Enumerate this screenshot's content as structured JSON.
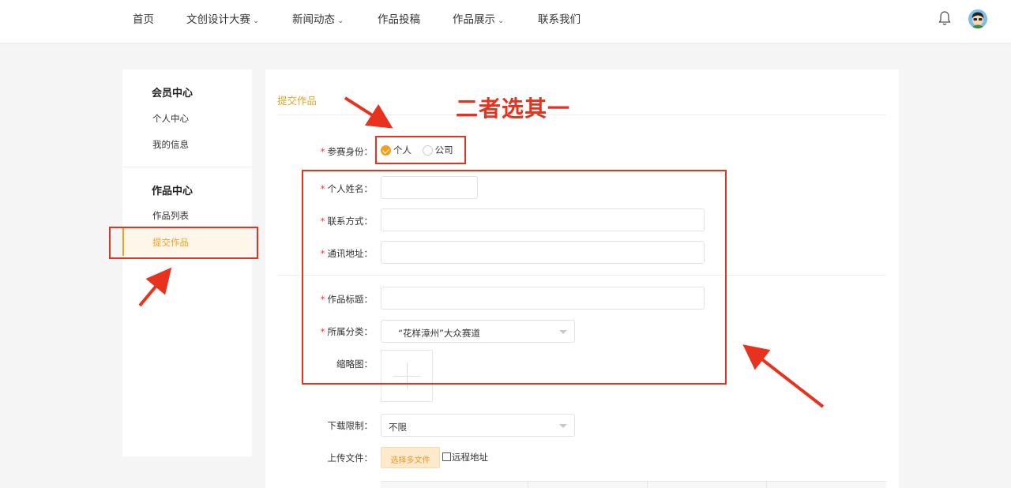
{
  "nav": {
    "items": [
      {
        "label": "首页",
        "has_dropdown": false
      },
      {
        "label": "文创设计大赛",
        "has_dropdown": true
      },
      {
        "label": "新闻动态",
        "has_dropdown": true
      },
      {
        "label": "作品投稿",
        "has_dropdown": false
      },
      {
        "label": "作品展示",
        "has_dropdown": true
      },
      {
        "label": "联系我们",
        "has_dropdown": false
      }
    ],
    "chevron": "⌄",
    "icons": [
      "bell-icon",
      "avatar"
    ]
  },
  "sidebar": {
    "groups": [
      {
        "title": "会员中心",
        "items": [
          {
            "label": "个人中心"
          },
          {
            "label": "我的信息"
          }
        ]
      },
      {
        "title": "作品中心",
        "items": [
          {
            "label": "作品列表"
          },
          {
            "label": "提交作品",
            "active": true
          }
        ]
      }
    ]
  },
  "form": {
    "title": "提交作品",
    "identity": {
      "label": "参赛身份：",
      "options": [
        {
          "label": "个人",
          "checked": true
        },
        {
          "label": "公司",
          "checked": false
        }
      ]
    },
    "name": {
      "label": "个人姓名：",
      "value": ""
    },
    "contact": {
      "label": "联系方式：",
      "value": ""
    },
    "address": {
      "label": "通讯地址：",
      "value": ""
    },
    "work_title": {
      "label": "作品标题：",
      "value": ""
    },
    "category": {
      "label": "所属分类：",
      "value": "“花样漳州”大众赛道"
    },
    "thumbnail": {
      "label": "缩略图："
    },
    "download_limit": {
      "label": "下载限制：",
      "value": "不限"
    },
    "upload": {
      "label": "上传文件：",
      "button": "选择多文件",
      "remote_label": "远程地址",
      "remote_checked": false
    },
    "required_mark": "*"
  },
  "annotation": {
    "text": "二者选其一",
    "color": "#e8321e"
  },
  "colors": {
    "accent": "#f0a020",
    "annotation_red": "#e8321e",
    "required": "#e33"
  }
}
